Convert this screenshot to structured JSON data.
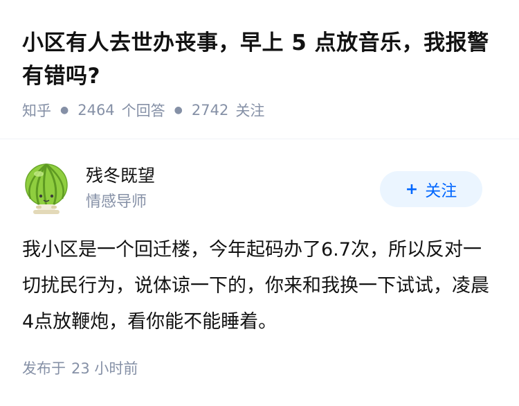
{
  "question": {
    "title": "小区有人去世办丧事，早上 5 点放音乐，我报警有错吗?",
    "source": "知乎",
    "answer_count": "2464",
    "answer_label": "个回答",
    "follower_count": "2742",
    "follower_label": "关注"
  },
  "answer": {
    "author_name": "残冬既望",
    "author_badge": "情感导师",
    "avatar_icon": "melon-character-avatar-icon",
    "follow_button": {
      "icon": "plus-icon",
      "plus": "+",
      "label": "关注"
    },
    "content": "我小区是一个回迁楼，今年起码办了6.7次，所以反对一切扰民行为，说体谅一下的，你来和我换一下试试，凌晨4点放鞭炮，看你能不能睡着。",
    "publish_prefix": "发布于",
    "publish_time": "23 小时前"
  },
  "colors": {
    "title": "#121212",
    "meta": "#8590a6",
    "follow_bg": "#ebf5ff",
    "follow_text": "#0066ff"
  }
}
